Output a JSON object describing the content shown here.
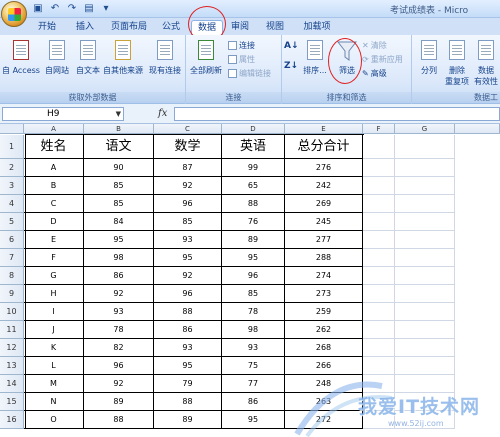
{
  "window": {
    "title": "考试成绩表 - Micro"
  },
  "tabs": [
    {
      "label": "开始"
    },
    {
      "label": "插入"
    },
    {
      "label": "页面布局"
    },
    {
      "label": "公式"
    },
    {
      "label": "数据"
    },
    {
      "label": "审阅"
    },
    {
      "label": "视图"
    },
    {
      "label": "加载项"
    }
  ],
  "ribbon": {
    "group1": {
      "label": "获取外部数据",
      "access": "自 Access",
      "web": "自网站",
      "text": "自文本",
      "other": "自其他来源",
      "existing": "现有连接"
    },
    "group2": {
      "label": "连接",
      "refresh": "全部刷新",
      "connections": "连接",
      "properties": "属性",
      "edit_links": "编辑链接"
    },
    "group3": {
      "label": "排序和筛选",
      "sort": "排序...",
      "filter": "筛选",
      "clear": "清除",
      "reapply": "重新应用",
      "advanced": "高级"
    },
    "group4": {
      "label": "数据工",
      "split": "分列",
      "remove_dup_1": "删除",
      "remove_dup_2": "重复项",
      "validate_1": "数据",
      "validate_2": "有效性"
    }
  },
  "formula_bar": {
    "name_box": "H9",
    "fx": "fx"
  },
  "sheet": {
    "columns": [
      "A",
      "B",
      "C",
      "D",
      "E",
      "F",
      "G"
    ],
    "headers": [
      "姓名",
      "语文",
      "数学",
      "英语",
      "总分合计"
    ],
    "rows": [
      [
        "A",
        "90",
        "87",
        "99",
        "276"
      ],
      [
        "B",
        "85",
        "92",
        "65",
        "242"
      ],
      [
        "C",
        "85",
        "96",
        "88",
        "269"
      ],
      [
        "D",
        "84",
        "85",
        "76",
        "245"
      ],
      [
        "E",
        "95",
        "93",
        "89",
        "277"
      ],
      [
        "F",
        "98",
        "95",
        "95",
        "288"
      ],
      [
        "G",
        "86",
        "92",
        "96",
        "274"
      ],
      [
        "H",
        "92",
        "96",
        "85",
        "273"
      ],
      [
        "I",
        "93",
        "88",
        "78",
        "259"
      ],
      [
        "J",
        "78",
        "86",
        "98",
        "262"
      ],
      [
        "K",
        "82",
        "93",
        "93",
        "268"
      ],
      [
        "L",
        "96",
        "95",
        "75",
        "266"
      ],
      [
        "M",
        "92",
        "79",
        "77",
        "248"
      ],
      [
        "N",
        "89",
        "88",
        "86",
        "263"
      ],
      [
        "O",
        "88",
        "89",
        "95",
        "272"
      ]
    ]
  },
  "watermark": {
    "text": "我爱IT技术网",
    "url": "www.52ij.com"
  }
}
